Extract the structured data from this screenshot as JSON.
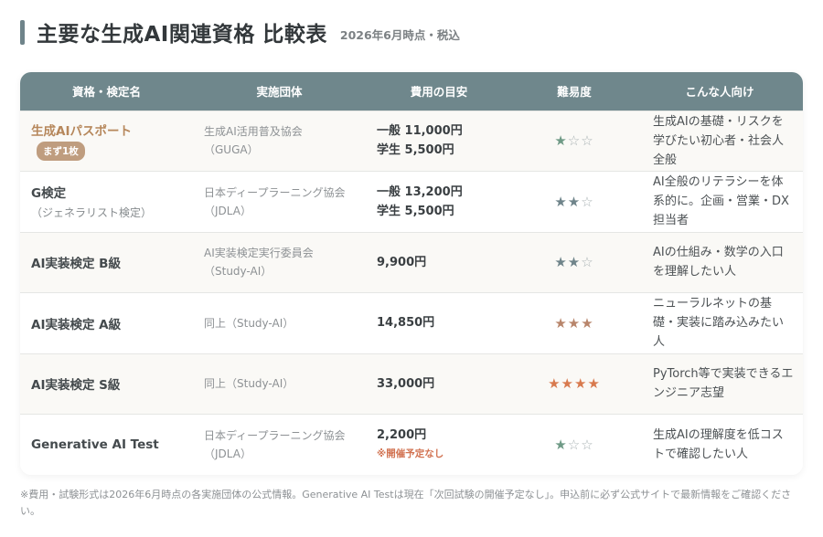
{
  "header": {
    "title": "主要な生成AI関連資格 比較表",
    "subtitle": "2026年6月時点・税込"
  },
  "columns": [
    "資格・検定名",
    "実施団体",
    "費用の目安",
    "難易度",
    "こんな人向け"
  ],
  "rows": [
    {
      "name": "生成AIパスポート",
      "name_sub": "",
      "badge": "まず1枚",
      "org": [
        "生成AI活用普及協会",
        "（GUGA）"
      ],
      "fee": [
        "一般 11,000円",
        "学生 5,500円"
      ],
      "fee_note": "",
      "difficulty": 1,
      "star_color": "#6f9a86",
      "target": "生成AIの基礎・リスクを学びたい初心者・社会人全般"
    },
    {
      "name": "G検定",
      "name_sub": "（ジェネラリスト検定）",
      "badge": "",
      "org": [
        "日本ディープラーニング協会",
        "（JDLA）"
      ],
      "fee": [
        "一般 13,200円",
        "学生 5,500円"
      ],
      "fee_note": "",
      "difficulty": 2,
      "star_color": "#6f848a",
      "target": "AI全般のリテラシーを体系的に。企画・営業・DX担当者"
    },
    {
      "name": "AI実装検定 B級",
      "name_sub": "",
      "badge": "",
      "org": [
        "AI実装検定実行委員会",
        "（Study-AI）"
      ],
      "fee": [
        "9,900円"
      ],
      "fee_note": "",
      "difficulty": 2,
      "star_color": "#6f848a",
      "target": "AIの仕組み・数学の入口を理解したい人"
    },
    {
      "name": "AI実装検定 A級",
      "name_sub": "",
      "badge": "",
      "org": [
        "同上（Study-AI）"
      ],
      "fee": [
        "14,850円"
      ],
      "fee_note": "",
      "difficulty": 3,
      "star_color": "#b8856b",
      "target": "ニューラルネットの基礎・実装に踏み込みたい人"
    },
    {
      "name": "AI実装検定 S級",
      "name_sub": "",
      "badge": "",
      "org": [
        "同上（Study-AI）"
      ],
      "fee": [
        "33,000円"
      ],
      "fee_note": "",
      "difficulty": 4,
      "star_color": "#d87a4e",
      "target": "PyTorch等で実装できるエンジニア志望"
    },
    {
      "name": "Generative AI Test",
      "name_sub": "",
      "badge": "",
      "org": [
        "日本ディープラーニング協会",
        "（JDLA）"
      ],
      "fee": [
        "2,200円"
      ],
      "fee_note": "※開催予定なし",
      "difficulty": 1,
      "star_color": "#6f9a86",
      "target": "生成AIの理解度を低コストで確認したい人"
    }
  ],
  "stars": {
    "filled": "★",
    "empty": "☆"
  },
  "footnote": "※費用・試験形式は2026年6月時点の各実施団体の公式情報。Generative AI Testは現在「次回試験の開催予定なし」。申込前に必ず公式サイトで最新情報をご確認ください。"
}
